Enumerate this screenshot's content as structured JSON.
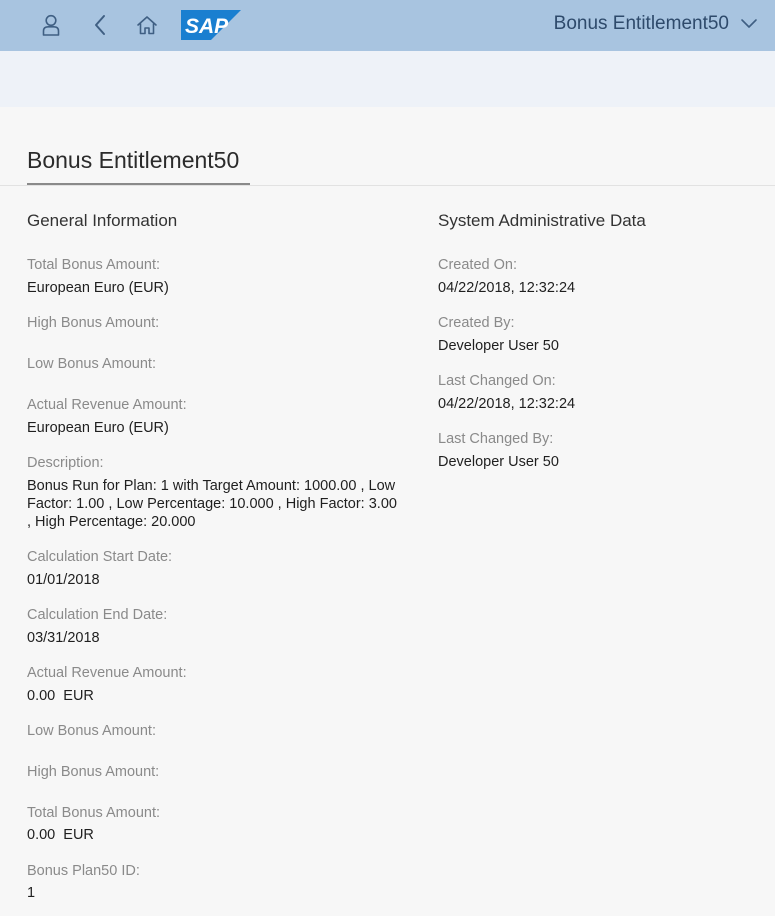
{
  "shell": {
    "app_title": "Bonus Entitlement50",
    "icons": {
      "user": "user-icon",
      "back": "back-icon",
      "home": "home-icon",
      "logo": "sap-logo",
      "menu": "chevron-down-icon"
    },
    "logo_text": "SAP",
    "colors": {
      "shell_bg": "#a8c4e0",
      "logo_blue": "#1a7fd0"
    }
  },
  "object": {
    "title": "Bonus Entitlement50"
  },
  "general": {
    "title": "General Information",
    "fields": [
      {
        "label": "Total Bonus Amount:",
        "value": "European Euro (EUR)"
      },
      {
        "label": "High Bonus Amount:",
        "value": ""
      },
      {
        "label": "Low Bonus Amount:",
        "value": ""
      },
      {
        "label": "Actual Revenue Amount:",
        "value": "European Euro (EUR)"
      },
      {
        "label": "Description:",
        "value": "Bonus Run for Plan: 1 with Target Amount: 1000.00 , Low Factor: 1.00 , Low Percentage: 10.000 , High Factor: 3.00 , High Percentage: 20.000"
      },
      {
        "label": "Calculation Start Date:",
        "value": "01/01/2018"
      },
      {
        "label": "Calculation End Date:",
        "value": "03/31/2018"
      },
      {
        "label": "Actual Revenue Amount:",
        "value": "0.00  EUR"
      },
      {
        "label": "Low Bonus Amount:",
        "value": ""
      },
      {
        "label": "High Bonus Amount:",
        "value": ""
      },
      {
        "label": "Total Bonus Amount:",
        "value": "0.00  EUR"
      },
      {
        "label": "Bonus Plan50 ID:",
        "value": "1"
      }
    ]
  },
  "admin": {
    "title": "System Administrative Data",
    "fields": [
      {
        "label": "Created On:",
        "value": "04/22/2018, 12:32:24"
      },
      {
        "label": "Created By:",
        "value": "Developer User 50"
      },
      {
        "label": "Last Changed On:",
        "value": "04/22/2018, 12:32:24"
      },
      {
        "label": "Last Changed By:",
        "value": "Developer User 50"
      }
    ]
  }
}
